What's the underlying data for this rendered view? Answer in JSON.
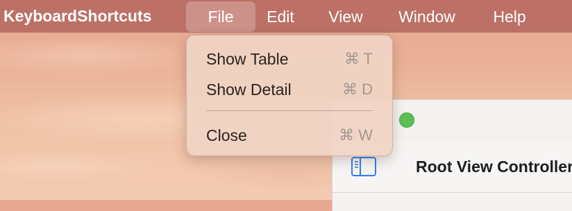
{
  "menubar": {
    "app_name": "KeyboardShortcuts",
    "menus": [
      {
        "label": "File",
        "active": true
      },
      {
        "label": "Edit"
      },
      {
        "label": "View"
      },
      {
        "label": "Window"
      },
      {
        "label": "Help"
      }
    ]
  },
  "file_menu": {
    "items": [
      {
        "label": "Show Table",
        "shortcut": "⌘ T"
      },
      {
        "label": "Show Detail",
        "shortcut": "⌘ D"
      },
      {
        "label": "Close",
        "shortcut": "⌘ W"
      }
    ]
  },
  "window": {
    "title": "Root View Controller",
    "sidebar_icon": "sidebar-toggle-icon"
  },
  "colors": {
    "menubar": "#aa5a55",
    "traffic_green": "#5ac054",
    "accent_blue": "#2f7ef0"
  }
}
